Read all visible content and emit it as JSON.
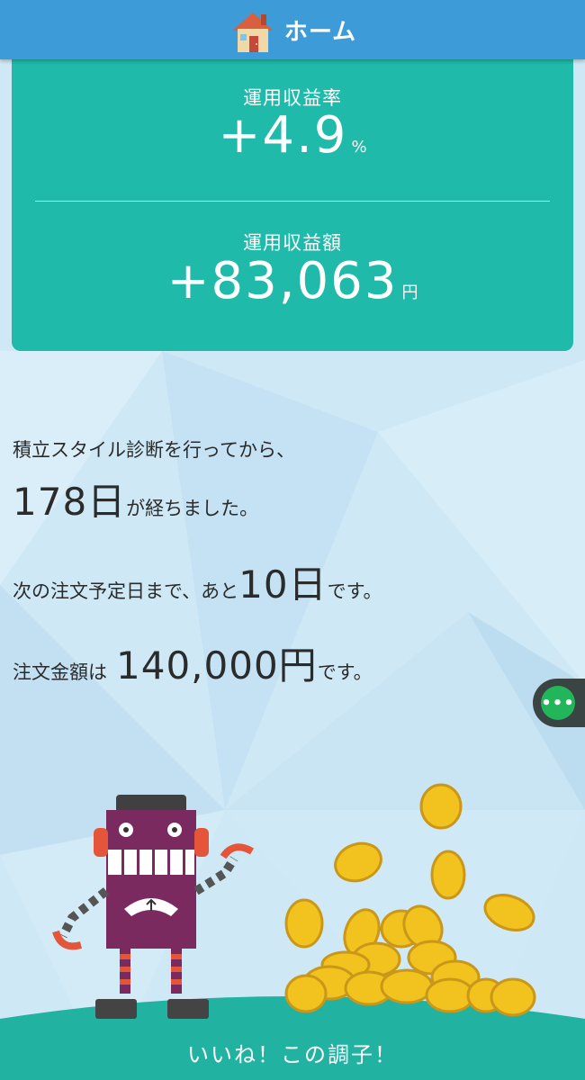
{
  "header": {
    "title": "ホーム",
    "icon": "house-icon"
  },
  "summary": {
    "rate_label": "運用収益率",
    "rate_value": "+4.9",
    "rate_unit": "%",
    "amount_label": "運用収益額",
    "amount_value": "+83,063",
    "amount_unit": "円"
  },
  "messages": {
    "line1": "積立スタイル診断を行ってから、",
    "days_elapsed": "178日",
    "days_suffix": "が経ちました。",
    "next_order_prefix": "次の注文予定日まで、あと",
    "next_order_days": "10日",
    "next_order_suffix": "です。",
    "amount_prefix": "注文金額は",
    "order_amount": "140,000円",
    "amount_suffix": "です。"
  },
  "menu_button": {
    "label": "•••",
    "icon": "more-dots-icon"
  },
  "footer": {
    "text": "いいね！この調子！"
  },
  "colors": {
    "header": "#3d9cd8",
    "card": "#1fbaa9",
    "menu": "#22b55a",
    "ground": "#22b2a2"
  }
}
